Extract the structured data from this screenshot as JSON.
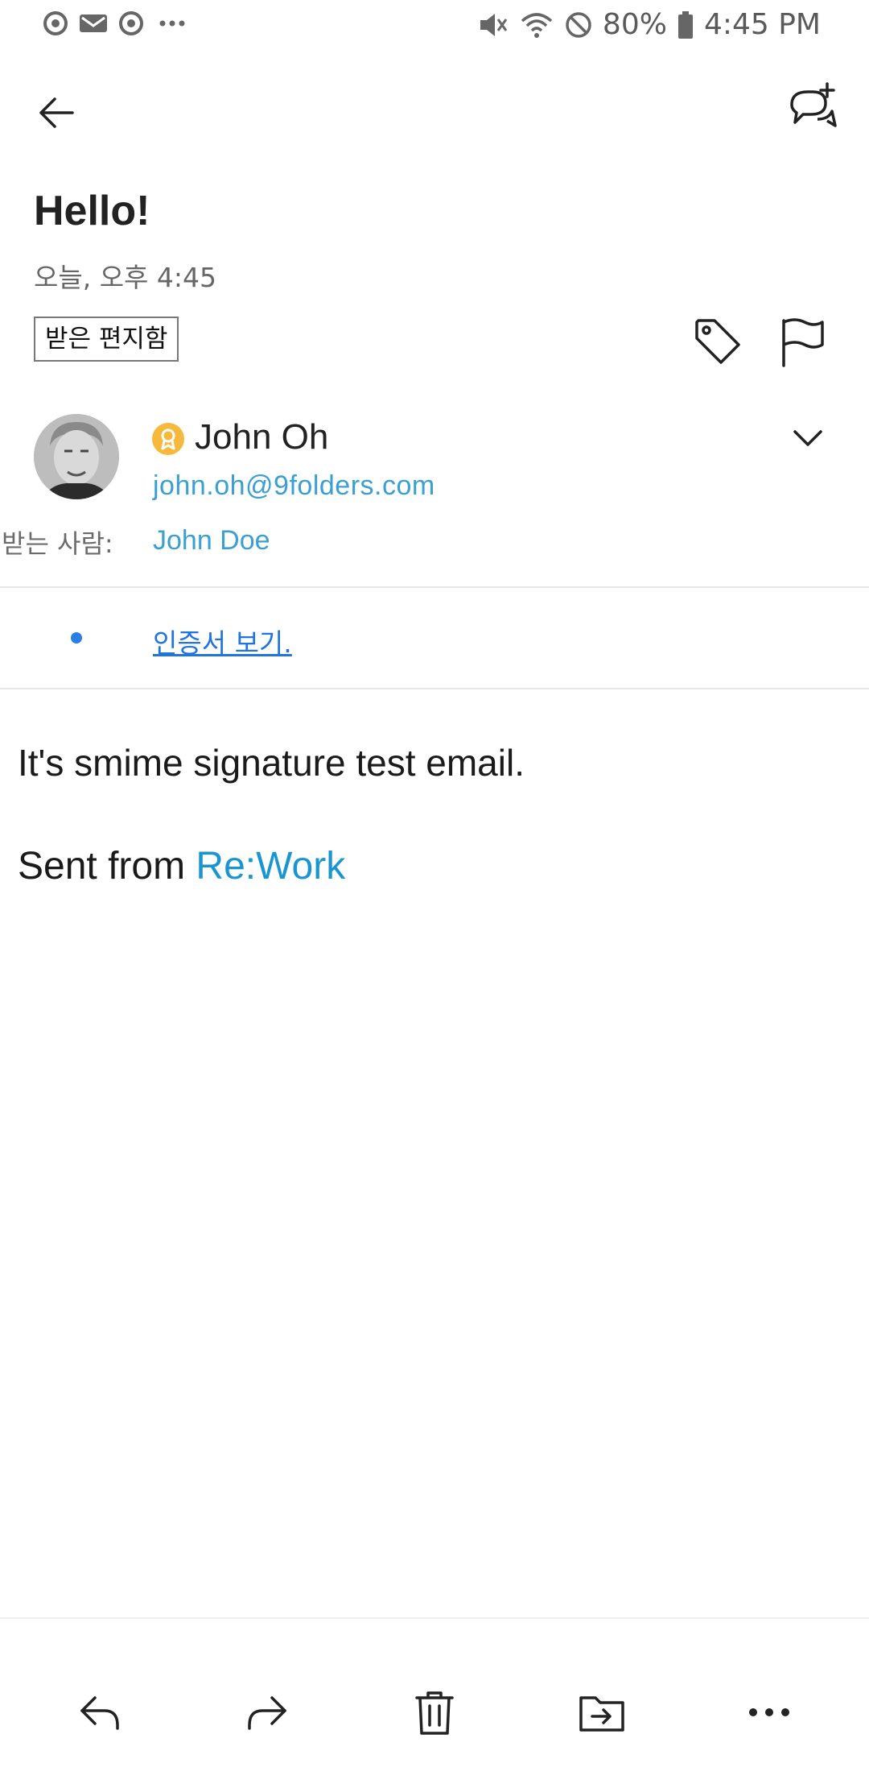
{
  "status_bar": {
    "battery": "80%",
    "time": "4:45 PM"
  },
  "email": {
    "subject": "Hello!",
    "date": "오늘, 오후 4:45",
    "folder": "받은 편지함",
    "sender_name": "John Oh",
    "sender_email": "john.oh@9folders.com",
    "to_label": "받는 사람:",
    "to_value": "John Doe",
    "certificate_link": "인증서 보기.",
    "body_line1": "It's smime signature test email.",
    "body_prefix": "Sent from ",
    "body_link": "Re:Work"
  },
  "colors": {
    "link": "#3b9fd1",
    "accent": "#1f74e0",
    "cert_badge": "#f6b93b"
  },
  "icons": {
    "back": "arrow-left-icon",
    "new_chat": "chat-add-icon",
    "tag": "tag-icon",
    "flag": "flag-icon",
    "expand": "chevron-down-icon",
    "reply": "reply-icon",
    "forward": "forward-icon",
    "delete": "trash-icon",
    "move": "folder-move-icon",
    "more": "more-icon"
  }
}
